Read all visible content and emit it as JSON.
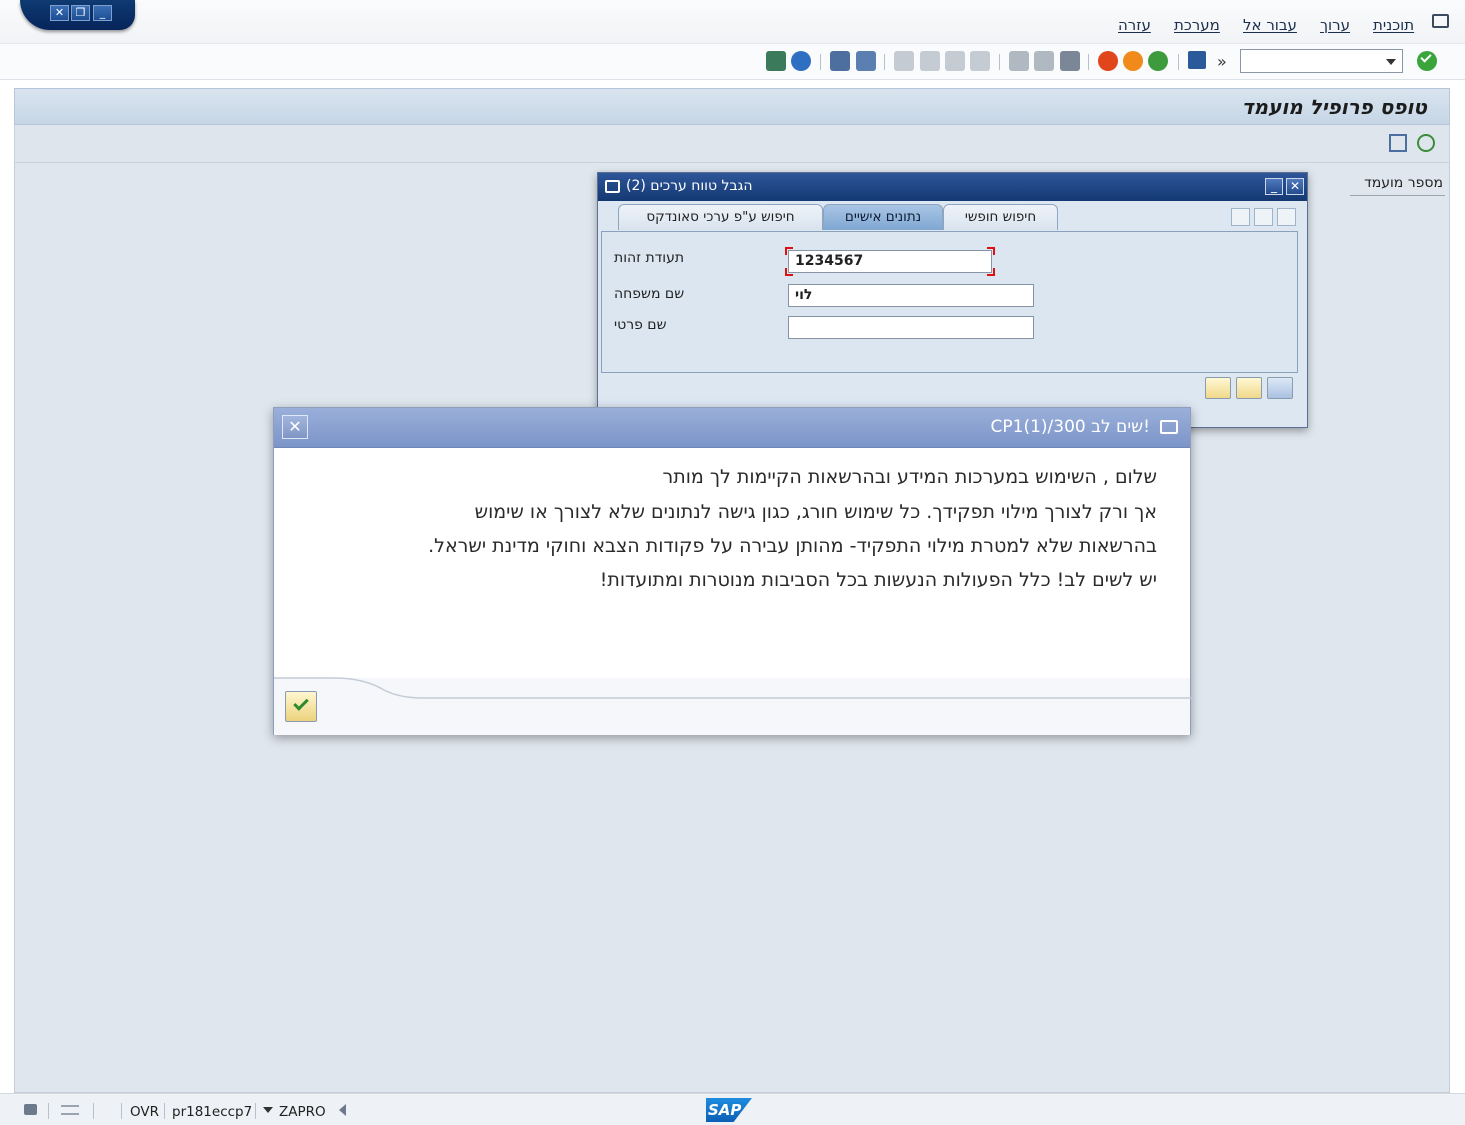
{
  "menu": {
    "items": [
      "תוכנית",
      "ערוך",
      "עבור אל",
      "מערכת",
      "עזרה"
    ]
  },
  "window_controls": {
    "close": "✕",
    "restore": "❐",
    "minimize": "_"
  },
  "toolbar": {
    "command_field": "",
    "enter_icon": "check-circle-icon",
    "expand_glyph": "»"
  },
  "title_bar": {
    "title": "טופס פרופיל מועמד"
  },
  "main": {
    "field_label": "מספר מועמד"
  },
  "value_help_dialog": {
    "title": "(2) הגבל טווח ערכים",
    "tabs": [
      "חיפוש חופשי",
      "נתונים אישיים",
      "חיפוש ע\"פ ערכי סאונדקס"
    ],
    "active_tab": "נתונים אישיים",
    "fields": [
      {
        "label": "תעודת זהות",
        "value": "1234567"
      },
      {
        "label": "שם משפחה",
        "value": "לוי"
      },
      {
        "label": "שם פרטי",
        "value": ""
      }
    ]
  },
  "warning_dialog": {
    "title": "CP1(1)/300 שים לב!",
    "lines": [
      "שלום , השימוש במערכות המידע ובהרשאות הקיימות לך מותר",
      "אך ורק לצורך מילוי תפקידך. כל שימוש חורג, כגון גישה לנתונים שלא לצורך או שימוש",
      "בהרשאות שלא למטרת מילוי התפקיד- מהותן עבירה על פקודות הצבא וחוקי מדינת ישראל.",
      "יש לשים לב! כלל הפעולות הנעשות בכל הסביבות מנוטרות ומתועדות!"
    ],
    "close_glyph": "✕"
  },
  "status_bar": {
    "mode": "OVR",
    "server": "pr181eccp7",
    "client": "ZAPRO",
    "logo": "SAP"
  },
  "colors": {
    "header_blue": "#143872",
    "dialog_header": "#8ea3d2",
    "background": "#dfe6ee"
  }
}
